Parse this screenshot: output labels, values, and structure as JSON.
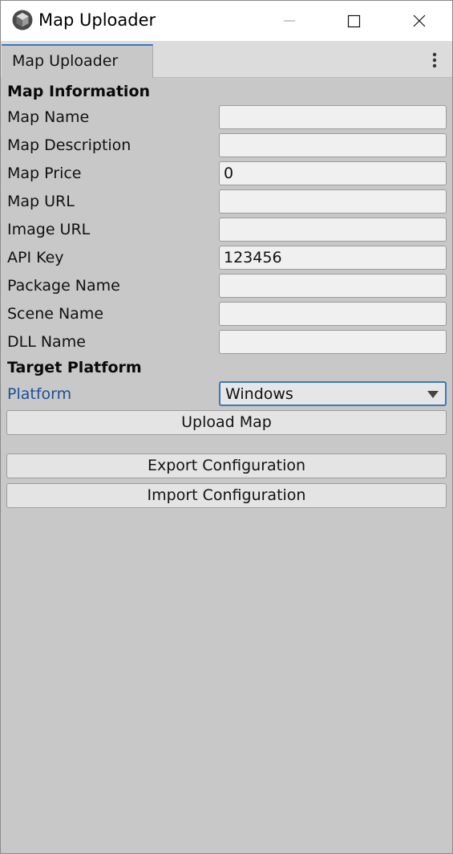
{
  "window": {
    "title": "Map Uploader",
    "icon": "unity-logo-icon",
    "controls": [
      "minimize-icon",
      "maximize-icon",
      "close-icon"
    ]
  },
  "tabs": [
    {
      "label": "Map Uploader",
      "active": true
    }
  ],
  "tab_menu_icon": "more-vertical-icon",
  "sections": {
    "map_info_title": "Map Information",
    "target_platform_title": "Target Platform"
  },
  "fields": [
    {
      "label": "Map Name",
      "value": ""
    },
    {
      "label": "Map Description",
      "value": ""
    },
    {
      "label": "Map Price",
      "value": "0"
    },
    {
      "label": "Map URL",
      "value": ""
    },
    {
      "label": "Image URL",
      "value": ""
    },
    {
      "label": "API Key",
      "value": "123456"
    },
    {
      "label": "Package Name",
      "value": ""
    },
    {
      "label": "Scene Name",
      "value": ""
    },
    {
      "label": "DLL Name",
      "value": ""
    }
  ],
  "platform": {
    "label": "Platform",
    "selected": "Windows"
  },
  "buttons": {
    "upload": "Upload Map",
    "export": "Export Configuration",
    "import": "Import Configuration"
  },
  "colors": {
    "accent": "#3a79bb",
    "highlight_label": "#1b4f97",
    "panel_bg": "#c8c8c8"
  }
}
